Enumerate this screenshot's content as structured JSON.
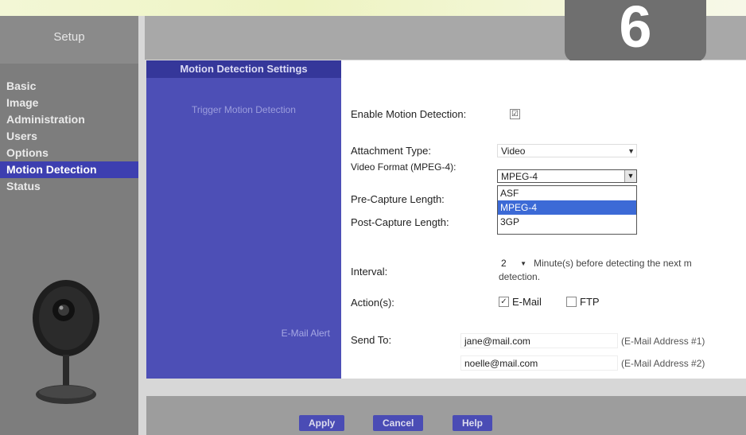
{
  "sidebar": {
    "title": "Setup",
    "items": [
      {
        "label": "Basic"
      },
      {
        "label": "Image"
      },
      {
        "label": "Administration"
      },
      {
        "label": "Users"
      },
      {
        "label": "Options"
      },
      {
        "label": "Motion Detection"
      },
      {
        "label": "Status"
      }
    ],
    "active_index": 5
  },
  "badge": {
    "step": "6"
  },
  "panel": {
    "title": "Motion Detection Settings",
    "trigger_label": "Trigger Motion Detection",
    "email_alert_label": "E-Mail Alert"
  },
  "form": {
    "enable_label": "Enable Motion Detection:",
    "enable_checked": "☑",
    "attachment_label": "Attachment Type:",
    "attachment_value": "Video",
    "video_format_label": "Video Format (MPEG-4):",
    "video_format_value": "MPEG-4",
    "video_format_options": [
      "ASF",
      "MPEG-4",
      "3GP"
    ],
    "video_format_selected_index": 1,
    "pre_capture_label": "Pre-Capture Length:",
    "post_capture_label": "Post-Capture Length:",
    "interval_label": "Interval:",
    "interval_value": "2",
    "interval_text": "Minute(s) before detecting the next m",
    "interval_text2": "detection.",
    "actions_label": "Action(s):",
    "action_email_label": "E-Mail",
    "action_ftp_label": "FTP",
    "send_to_label": "Send To:",
    "email1_value": "jane@mail.com",
    "email1_hint": "(E-Mail Address #1)",
    "email2_value": "noelle@mail.com",
    "email2_hint": "(E-Mail Address #2)"
  },
  "footer": {
    "apply_label": "Apply",
    "cancel_label": "Cancel",
    "help_label": "Help"
  },
  "colors": {
    "accent": "#3d3fb0",
    "panel": "#4d4fb6",
    "selected_option": "#3c6ad6"
  }
}
